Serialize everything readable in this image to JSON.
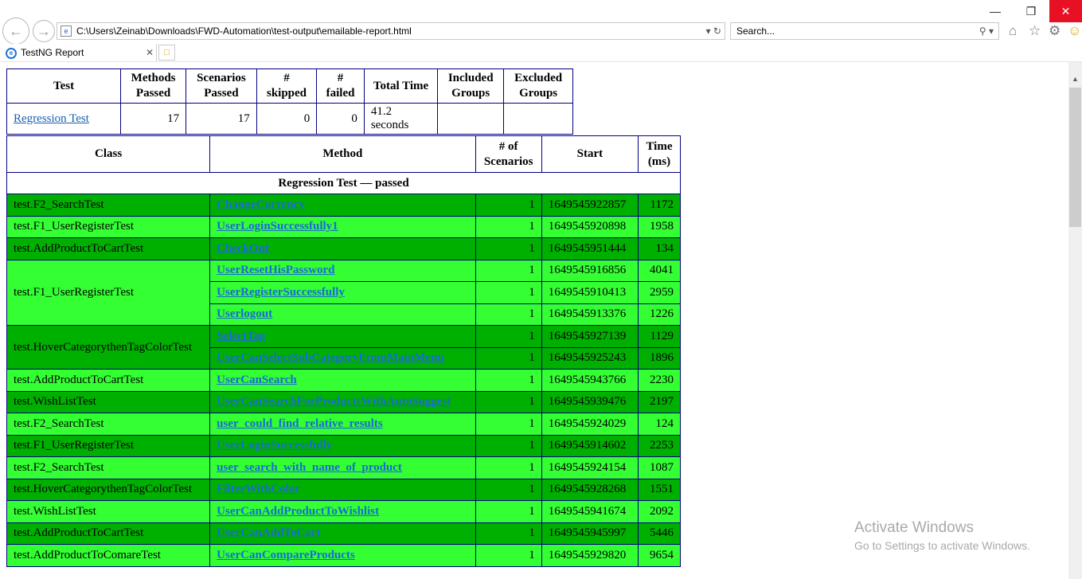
{
  "browser": {
    "address": "C:\\Users\\Zeinab\\Downloads\\FWD-Automation\\test-output\\emailable-report.html",
    "search_placeholder": "Search...",
    "tab_title": "TestNG Report"
  },
  "summary": {
    "headers": [
      "Test",
      "Methods Passed",
      "Scenarios Passed",
      "# skipped",
      "# failed",
      "Total Time",
      "Included Groups",
      "Excluded Groups"
    ],
    "row": {
      "test": "Regression Test",
      "methods_passed": "17",
      "scenarios_passed": "17",
      "skipped": "0",
      "failed": "0",
      "total_time": "41.2 seconds",
      "included_groups": "",
      "excluded_groups": ""
    }
  },
  "detail": {
    "headers": [
      "Class",
      "Method",
      "# of Scenarios",
      "Start",
      "Time (ms)"
    ],
    "group_title": "Regression Test — passed",
    "rows": [
      {
        "cls": "test.F2_SearchTest",
        "method": "ChangeCurrency",
        "scenarios": "1",
        "start": "1649545922857",
        "time": "1172"
      },
      {
        "cls": "test.F1_UserRegisterTest",
        "method": "UserLoginSuccessfully1",
        "scenarios": "1",
        "start": "1649545920898",
        "time": "1958"
      },
      {
        "cls": "test.AddProductToCartTest",
        "method": "CheckOut",
        "scenarios": "1",
        "start": "1649545951444",
        "time": "134"
      },
      {
        "cls": "test.F1_UserRegisterTest",
        "method": "UserResetHisPassword",
        "scenarios": "1",
        "start": "1649545916856",
        "time": "4041"
      },
      {
        "cls": "",
        "method": "UserRegisterSuccessfully",
        "scenarios": "1",
        "start": "1649545910413",
        "time": "2959"
      },
      {
        "cls": "",
        "method": "Userlogout",
        "scenarios": "1",
        "start": "1649545913376",
        "time": "1226"
      },
      {
        "cls": "test.HoverCategorythenTagColorTest",
        "method": "SelectTag",
        "scenarios": "1",
        "start": "1649545927139",
        "time": "1129"
      },
      {
        "cls": "",
        "method": "UserCanSelectSubCategoryFromMainMenu",
        "scenarios": "1",
        "start": "1649545925243",
        "time": "1896"
      },
      {
        "cls": "test.AddProductToCartTest",
        "method": "UserCanSearch",
        "scenarios": "1",
        "start": "1649545943766",
        "time": "2230"
      },
      {
        "cls": "test.WishListTest",
        "method": "UserCanSearchForProductsWithAutoSuggest",
        "scenarios": "1",
        "start": "1649545939476",
        "time": "2197"
      },
      {
        "cls": "test.F2_SearchTest",
        "method": "user_could_find_relative_results",
        "scenarios": "1",
        "start": "1649545924029",
        "time": "124"
      },
      {
        "cls": "test.F1_UserRegisterTest",
        "method": "UserLoginSuccessfully",
        "scenarios": "1",
        "start": "1649545914602",
        "time": "2253"
      },
      {
        "cls": "test.F2_SearchTest",
        "method": "user_search_with_name_of_product",
        "scenarios": "1",
        "start": "1649545924154",
        "time": "1087"
      },
      {
        "cls": "test.HoverCategorythenTagColorTest",
        "method": "FilterWithColor",
        "scenarios": "1",
        "start": "1649545928268",
        "time": "1551"
      },
      {
        "cls": "test.WishListTest",
        "method": "UserCanAddProductToWishlist",
        "scenarios": "1",
        "start": "1649545941674",
        "time": "2092"
      },
      {
        "cls": "test.AddProductToCartTest",
        "method": "UserCanAddToCart",
        "scenarios": "1",
        "start": "1649545945997",
        "time": "5446"
      },
      {
        "cls": "test.AddProductToComareTest",
        "method": "UserCanCompareProducts",
        "scenarios": "1",
        "start": "1649545929820",
        "time": "9654"
      }
    ]
  },
  "watermark": {
    "line1": "Activate Windows",
    "line2": "Go to Settings to activate Windows."
  },
  "colors": {
    "row_dark": "#00b000",
    "row_light": "#33ff33",
    "table_border": "#000080"
  }
}
